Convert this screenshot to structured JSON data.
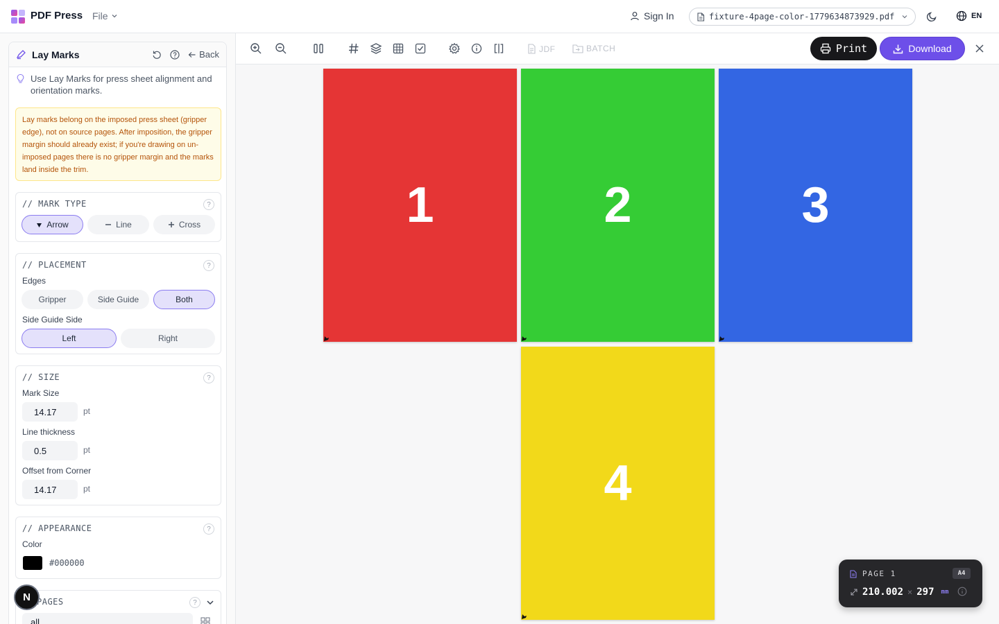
{
  "app": {
    "name": "PDF Press",
    "file_menu": "File"
  },
  "header": {
    "sign_in": "Sign In",
    "file_name": "fixture-4page-color-1779634873929.pdf",
    "language": "EN"
  },
  "panel": {
    "title": "Lay Marks",
    "back": "Back",
    "hint": "Use Lay Marks for press sheet alignment and orientation marks.",
    "warning": "Lay marks belong on the imposed press sheet (gripper edge), not on source pages. After imposition, the gripper margin should already exist; if you're drawing on un-imposed pages there is no gripper margin and the marks land inside the trim.",
    "mark_type": {
      "title": "// MARK TYPE",
      "options": [
        "Arrow",
        "Line",
        "Cross"
      ],
      "selected": "Arrow"
    },
    "placement": {
      "title": "// PLACEMENT",
      "edges_label": "Edges",
      "edges": [
        "Gripper",
        "Side Guide",
        "Both"
      ],
      "edges_selected": "Both",
      "side_label": "Side Guide Side",
      "sides": [
        "Left",
        "Right"
      ],
      "side_selected": "Left"
    },
    "size": {
      "title": "// SIZE",
      "mark_size_label": "Mark Size",
      "mark_size": "14.17",
      "thickness_label": "Line thickness",
      "thickness": "0.5",
      "offset_label": "Offset from Corner",
      "offset": "14.17",
      "unit": "pt"
    },
    "appearance": {
      "title": "// APPEARANCE",
      "color_label": "Color",
      "color": "#000000"
    },
    "pages": {
      "title": "PAGES",
      "value": "all"
    },
    "avatar_initial": "N"
  },
  "toolbar": {
    "jdf": "JDF",
    "batch": "BATCH",
    "print": "Print",
    "download": "Download"
  },
  "document": {
    "pages": [
      {
        "label": "1",
        "color": "#e53535"
      },
      {
        "label": "2",
        "color": "#35cc35"
      },
      {
        "label": "3",
        "color": "#3366e3"
      },
      {
        "label": "4",
        "color": "#f2d91a"
      }
    ]
  },
  "page_info": {
    "label": "PAGE 1",
    "size_name": "A4",
    "width": "210.002",
    "separator": "×",
    "height": "297",
    "unit": "mm"
  },
  "colors": {
    "accent": "#6d4fe9",
    "active_segment": "#e4e1fb",
    "warning_bg": "#fefce8",
    "warning_text": "#b45309"
  }
}
